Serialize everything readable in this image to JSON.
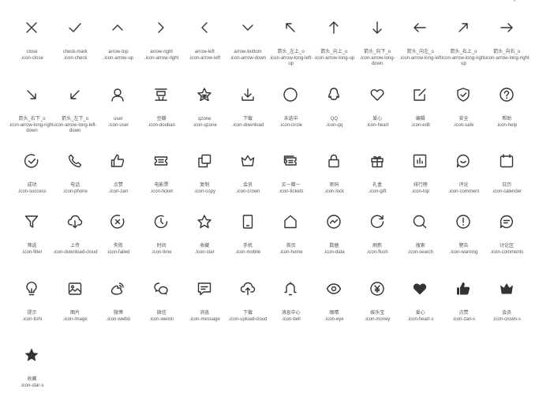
{
  "top_stubs": [
    {
      "col": 4,
      "text": "......"
    },
    {
      "col": 6,
      "text": "......"
    },
    {
      "col": 10,
      "text": "icon-arrow-.."
    },
    {
      "col": 11,
      "text": "...arrow-right"
    }
  ],
  "icons": [
    {
      "row": 0,
      "col": 0,
      "icon": "close-icon",
      "name": "close",
      "cls": ".icon-close"
    },
    {
      "row": 0,
      "col": 1,
      "icon": "check-icon",
      "name": "check-mark",
      "cls": ".icon-check"
    },
    {
      "row": 0,
      "col": 2,
      "icon": "arrow-top-icon",
      "name": "arrow-top",
      "cls": ".icon-arrow-up"
    },
    {
      "row": 0,
      "col": 3,
      "icon": "arrow-right-icon",
      "name": "arrow-right",
      "cls": ".icon-arrow-right"
    },
    {
      "row": 0,
      "col": 4,
      "icon": "arrow-left-icon",
      "name": "arrow-left",
      "cls": ".icon-arrow-left"
    },
    {
      "row": 0,
      "col": 5,
      "icon": "arrow-bottom-icon",
      "name": "arrow-bottom",
      "cls": ".icon-arrow-down"
    },
    {
      "row": 0,
      "col": 6,
      "icon": "arrow-long-left-up-icon",
      "name": "箭头_左上_o",
      "cls": ".icon-arrow-long-left-up"
    },
    {
      "row": 0,
      "col": 7,
      "icon": "arrow-long-up-icon",
      "name": "箭头_向上_o",
      "cls": ".icon-arrow-long-up"
    },
    {
      "row": 0,
      "col": 8,
      "icon": "arrow-long-down-icon",
      "name": "箭头_向下_o",
      "cls": ".icon-arrow-long-down"
    },
    {
      "row": 0,
      "col": 9,
      "icon": "arrow-long-left-icon",
      "name": "箭头_向左_o",
      "cls": ".icon-arrow-long-left"
    },
    {
      "row": 0,
      "col": 10,
      "icon": "arrow-long-right-up-icon",
      "name": "箭头_右上_o",
      "cls": ".icon-arrow-long-right-up"
    },
    {
      "row": 0,
      "col": 11,
      "icon": "arrow-long-right-icon",
      "name": "箭头_向右_o",
      "cls": ".icon-arrow-long-right"
    },
    {
      "row": 1,
      "col": 0,
      "icon": "arrow-long-right-down-icon",
      "name": "箭头_右下_o",
      "cls": ".icon-arrow-long-right-down"
    },
    {
      "row": 1,
      "col": 1,
      "icon": "arrow-long-left-down-icon",
      "name": "箭头_左下_o",
      "cls": ".icon-arrow-long-left-down"
    },
    {
      "row": 1,
      "col": 2,
      "icon": "user-icon",
      "name": "user",
      "cls": ".icon-user"
    },
    {
      "row": 1,
      "col": 3,
      "icon": "douban-icon",
      "name": "豆瓣",
      "cls": ".icon-douban"
    },
    {
      "row": 1,
      "col": 4,
      "icon": "qzone-icon",
      "name": "qzone",
      "cls": ".icon-qzone"
    },
    {
      "row": 1,
      "col": 5,
      "icon": "download-icon",
      "name": "下载",
      "cls": ".icon-download"
    },
    {
      "row": 1,
      "col": 6,
      "icon": "circle-icon",
      "name": "未选中",
      "cls": ".icon-circle"
    },
    {
      "row": 1,
      "col": 7,
      "icon": "qq-icon",
      "name": "QQ",
      "cls": ".icon-qq"
    },
    {
      "row": 1,
      "col": 8,
      "icon": "heart-icon",
      "name": "爱心",
      "cls": ".icon-heart"
    },
    {
      "row": 1,
      "col": 9,
      "icon": "edit-icon",
      "name": "编辑",
      "cls": ".icon-edit"
    },
    {
      "row": 1,
      "col": 10,
      "icon": "safe-icon",
      "name": "安全",
      "cls": ".icon-safe"
    },
    {
      "row": 1,
      "col": 11,
      "icon": "help-icon",
      "name": "帮助",
      "cls": ".icon-help"
    },
    {
      "row": 2,
      "col": 0,
      "icon": "success-icon",
      "name": "成功",
      "cls": ".icon-success"
    },
    {
      "row": 2,
      "col": 1,
      "icon": "phone-icon",
      "name": "电话",
      "cls": ".icon-phone"
    },
    {
      "row": 2,
      "col": 2,
      "icon": "zan-icon",
      "name": "点赞",
      "cls": ".icon-zan"
    },
    {
      "row": 2,
      "col": 3,
      "icon": "ticket-icon",
      "name": "电影票",
      "cls": ".icon-ticket"
    },
    {
      "row": 2,
      "col": 4,
      "icon": "copy-icon",
      "name": "复制",
      "cls": ".icon-copy"
    },
    {
      "row": 2,
      "col": 5,
      "icon": "crown-icon",
      "name": "会员",
      "cls": ".icon-crown"
    },
    {
      "row": 2,
      "col": 6,
      "icon": "tickets-icon",
      "name": "买一赠一",
      "cls": ".icon-tickets"
    },
    {
      "row": 2,
      "col": 7,
      "icon": "lock-icon",
      "name": "密码",
      "cls": ".icon-lock"
    },
    {
      "row": 2,
      "col": 8,
      "icon": "gift-icon",
      "name": "礼盒",
      "cls": ".icon-gift"
    },
    {
      "row": 2,
      "col": 9,
      "icon": "top-icon",
      "name": "排行榜",
      "cls": ".icon-top"
    },
    {
      "row": 2,
      "col": 10,
      "icon": "comment-icon",
      "name": "评论",
      "cls": ".icon-comment"
    },
    {
      "row": 2,
      "col": 11,
      "icon": "calendar-icon",
      "name": "日历",
      "cls": ".icon-calender"
    },
    {
      "row": 3,
      "col": 0,
      "icon": "filter-icon",
      "name": "筛选",
      "cls": ".icon-filter"
    },
    {
      "row": 3,
      "col": 1,
      "icon": "download-cloud-icon",
      "name": "上传",
      "cls": ".icon-download-cloud"
    },
    {
      "row": 3,
      "col": 2,
      "icon": "failed-icon",
      "name": "失败",
      "cls": ".icon-failed"
    },
    {
      "row": 3,
      "col": 3,
      "icon": "time-icon",
      "name": "时间",
      "cls": ".icon-time"
    },
    {
      "row": 3,
      "col": 4,
      "icon": "star-icon",
      "name": "收藏",
      "cls": ".icon-star"
    },
    {
      "row": 3,
      "col": 5,
      "icon": "mobile-icon",
      "name": "手机",
      "cls": ".icon-mobile"
    },
    {
      "row": 3,
      "col": 6,
      "icon": "home-icon",
      "name": "首页",
      "cls": ".icon-home"
    },
    {
      "row": 3,
      "col": 7,
      "icon": "data-icon",
      "name": "数据",
      "cls": ".icon-data"
    },
    {
      "row": 3,
      "col": 8,
      "icon": "flush-icon",
      "name": "刷新",
      "cls": ".icon-flush"
    },
    {
      "row": 3,
      "col": 9,
      "icon": "search-icon",
      "name": "搜索",
      "cls": ".icon-search"
    },
    {
      "row": 3,
      "col": 10,
      "icon": "warning-icon",
      "name": "警告",
      "cls": ".icon-warning"
    },
    {
      "row": 3,
      "col": 11,
      "icon": "comments-icon",
      "name": "讨论区",
      "cls": ".icon-comments"
    },
    {
      "row": 4,
      "col": 0,
      "icon": "lightbulb-icon",
      "name": "提示",
      "cls": ".icon-tishi"
    },
    {
      "row": 4,
      "col": 1,
      "icon": "image-icon",
      "name": "图片",
      "cls": ".icon-image"
    },
    {
      "row": 4,
      "col": 2,
      "icon": "weibo-icon",
      "name": "微博",
      "cls": ".icon-weibo"
    },
    {
      "row": 4,
      "col": 3,
      "icon": "wechat-icon",
      "name": "微信",
      "cls": ".icon-weixin"
    },
    {
      "row": 4,
      "col": 4,
      "icon": "message-icon",
      "name": "消息",
      "cls": ".icon-message"
    },
    {
      "row": 4,
      "col": 5,
      "icon": "upload-cloud-icon",
      "name": "下载",
      "cls": ".icon-upload-cloud"
    },
    {
      "row": 4,
      "col": 6,
      "icon": "bell-icon",
      "name": "消息中心",
      "cls": ".icon-bell"
    },
    {
      "row": 4,
      "col": 7,
      "icon": "eye-icon",
      "name": "眼睛",
      "cls": ".icon-eye"
    },
    {
      "row": 4,
      "col": 8,
      "icon": "money-icon",
      "name": "娱乐宝",
      "cls": ".icon-money"
    },
    {
      "row": 4,
      "col": 9,
      "icon": "heart-solid-icon",
      "name": "爱心",
      "cls": ".icon-heart-s"
    },
    {
      "row": 4,
      "col": 10,
      "icon": "zan-solid-icon",
      "name": "点赞",
      "cls": ".icon-zan-s"
    },
    {
      "row": 4,
      "col": 11,
      "icon": "crown-solid-icon",
      "name": "会员",
      "cls": ".icon-crown-s"
    },
    {
      "row": 5,
      "col": 0,
      "icon": "star-solid-icon",
      "name": "收藏",
      "cls": ".icon-star-s"
    }
  ]
}
